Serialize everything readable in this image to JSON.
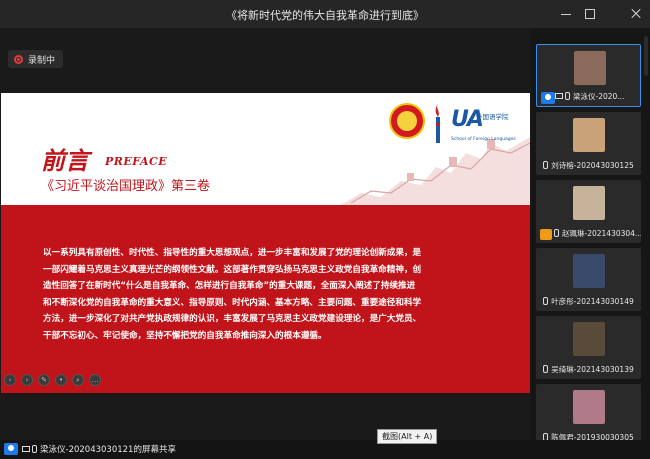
{
  "window": {
    "title": "《将新时代党的伟大自我革命进行到底》"
  },
  "recording": {
    "label": "录制中"
  },
  "slide": {
    "heading_cn": "前言",
    "heading_en": "PREFACE",
    "book_title": "《习近平谈治国理政》第三卷",
    "school_mark": "UA",
    "school_name_cn": "外国语学院",
    "school_name_en": "School of Foreign Languages",
    "body": [
      "以一系列具有原创性、时代性、指导性的重大思想观点，进一步丰富和发展了党的理论创新成果，是",
      "一部闪耀着马克思主义真理光芒的纲领性文献。这部著作贯穿弘扬马克思主义政党自我革命精神，创",
      "造性回答了在新时代“什么是自我革命、怎样进行自我革命”的重大课题，全面深入阐述了持续推进",
      "和不断深化党的自我革命的重大意义、指导原则、时代内涵、基本方略、主要问题、重要途径和科学",
      "方法，进一步深化了对共产党执政规律的认识，丰富发展了马克思主义政党建设理论，是广大党员、",
      "干部不忘初心、牢记使命，坚持不懈把党的自我革命推向深入的根本遵循。"
    ]
  },
  "participants": [
    {
      "name": "梁泳仪-2020...",
      "avatar_color": "#8a6a5a",
      "active": true
    },
    {
      "name": "刘诗榕-202043030125",
      "avatar_color": "#c9a27a",
      "active": false
    },
    {
      "name": "赵珮琳-2021430304...",
      "avatar_color": "#c7b29a",
      "active": false
    },
    {
      "name": "叶彦彤-202143030149",
      "avatar_color": "#3a4a6a",
      "active": false
    },
    {
      "name": "吴绮琳-202143030139",
      "avatar_color": "#5a4a3a",
      "active": false
    },
    {
      "name": "陈佩君-201930030305",
      "avatar_color": "#b07a8a",
      "active": false
    }
  ],
  "status": {
    "sharing_text": "梁泳仪-202043030121的屏幕共享",
    "tooltip": "截图(Alt + A)"
  }
}
